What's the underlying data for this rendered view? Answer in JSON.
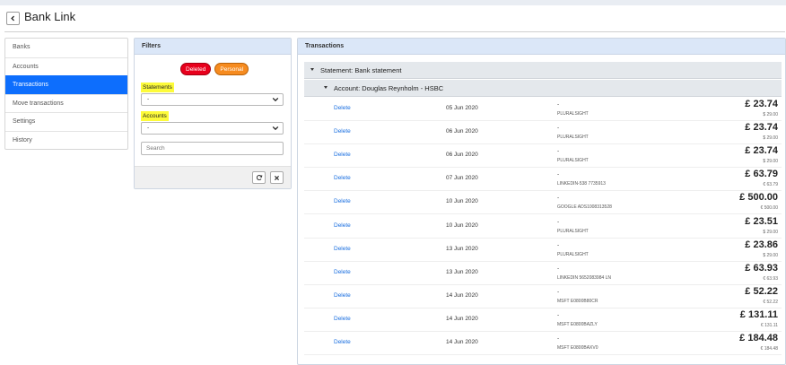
{
  "header": {
    "title": "Bank Link",
    "back_icon": "chevron-left-icon"
  },
  "sidebar": {
    "items": [
      {
        "label": "Banks"
      },
      {
        "label": "Accounts"
      },
      {
        "label": "Transactions",
        "active": true
      },
      {
        "label": "Move transactions"
      },
      {
        "label": "Settings"
      },
      {
        "label": "History"
      }
    ]
  },
  "filters": {
    "title": "Filters",
    "badge_deleted": "Deleted",
    "badge_personal": "Personal",
    "statements_label": "Statements",
    "statements_value": "-",
    "accounts_label": "Accounts",
    "accounts_value": "-",
    "search_placeholder": "Search",
    "refresh_icon": "refresh-icon",
    "clear_icon": "close-icon"
  },
  "transactions": {
    "title": "Transactions",
    "statement_group": "Statement: Bank statement",
    "account_group": "Account: Douglas Reynholm - HSBC",
    "delete_label": "Delete",
    "rows": [
      {
        "date": "05 Jun 2020",
        "dash": "-",
        "desc": "PLURALSIGHT",
        "amount": "£ 23.74",
        "orig": "$ 29.00"
      },
      {
        "date": "06 Jun 2020",
        "dash": "-",
        "desc": "PLURALSIGHT",
        "amount": "£ 23.74",
        "orig": "$ 29.00"
      },
      {
        "date": "06 Jun 2020",
        "dash": "-",
        "desc": "PLURALSIGHT",
        "amount": "£ 23.74",
        "orig": "$ 29.00"
      },
      {
        "date": "07 Jun 2020",
        "dash": "-",
        "desc": "LINKEDIN-538 7735913",
        "amount": "£ 63.79",
        "orig": "€ 63.79"
      },
      {
        "date": "10 Jun 2020",
        "dash": "-",
        "desc": "GOOGLE ADS1008313528",
        "amount": "£ 500.00",
        "orig": "€ 500.00"
      },
      {
        "date": "10 Jun 2020",
        "dash": "-",
        "desc": "PLURALSIGHT",
        "amount": "£ 23.51",
        "orig": "$ 29.00"
      },
      {
        "date": "13 Jun 2020",
        "dash": "-",
        "desc": "PLURALSIGHT",
        "amount": "£ 23.86",
        "orig": "$ 29.00"
      },
      {
        "date": "13 Jun 2020",
        "dash": "-",
        "desc": "LINKEDIN 5652083984 LN",
        "amount": "£ 63.93",
        "orig": "€ 63.93"
      },
      {
        "date": "14 Jun 2020",
        "dash": "-",
        "desc": "MSFT E0800B80CR",
        "amount": "£ 52.22",
        "orig": "€ 52.22"
      },
      {
        "date": "14 Jun 2020",
        "dash": "-",
        "desc": "MSFT E0800BAZLY",
        "amount": "£ 131.11",
        "orig": "€ 131.11"
      },
      {
        "date": "14 Jun 2020",
        "dash": "-",
        "desc": "MSFT E0800BAXV0",
        "amount": "£ 184.48",
        "orig": "€ 184.48"
      }
    ]
  },
  "colors": {
    "active_nav": "#0d6efd",
    "panel_header": "#dbe7f8",
    "deleted_badge": "#e8001c",
    "personal_badge": "#f68b1f",
    "highlight": "#fdfb3a",
    "link": "#1a6fe0"
  }
}
